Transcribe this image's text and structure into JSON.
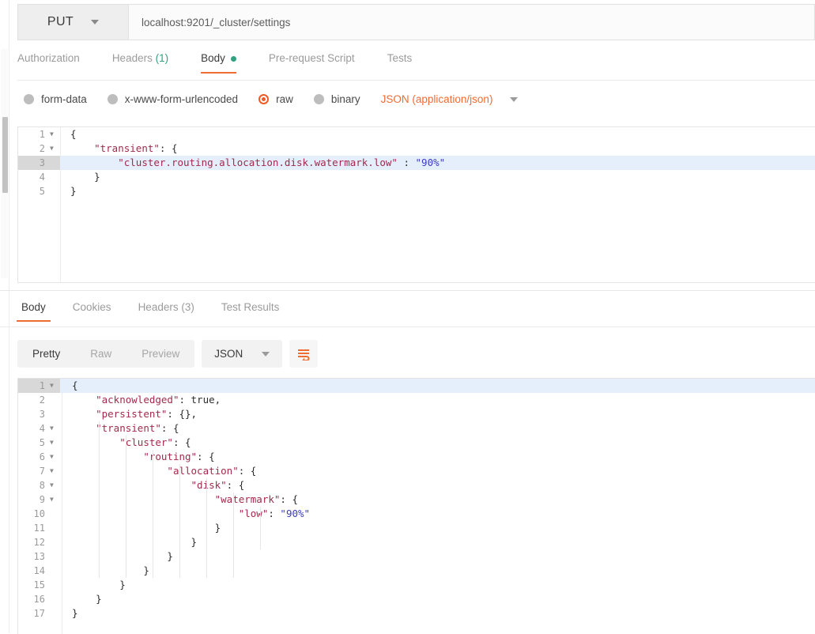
{
  "request": {
    "method": "PUT",
    "url": "localhost:9201/_cluster/settings",
    "tabs": [
      {
        "label": "Authorization",
        "active": false,
        "count": "",
        "dot": false
      },
      {
        "label": "Headers",
        "active": false,
        "count": "(1)",
        "dot": false
      },
      {
        "label": "Body",
        "active": true,
        "count": "",
        "dot": true
      },
      {
        "label": "Pre-request Script",
        "active": false,
        "count": "",
        "dot": false
      },
      {
        "label": "Tests",
        "active": false,
        "count": "",
        "dot": false
      }
    ],
    "body_types": [
      {
        "label": "form-data",
        "selected": false
      },
      {
        "label": "x-www-form-urlencoded",
        "selected": false
      },
      {
        "label": "raw",
        "selected": true
      },
      {
        "label": "binary",
        "selected": false
      }
    ],
    "content_type": "JSON (application/json)",
    "body_lines": [
      {
        "num": "1",
        "fold": "▾",
        "highlight": false,
        "text": "{"
      },
      {
        "num": "2",
        "fold": "▾",
        "highlight": false,
        "text": "    \"transient\": {"
      },
      {
        "num": "3",
        "fold": "",
        "highlight": true,
        "text": "        \"cluster.routing.allocation.disk.watermark.low\" : \"90%\""
      },
      {
        "num": "4",
        "fold": "",
        "highlight": false,
        "text": "    }"
      },
      {
        "num": "5",
        "fold": "",
        "highlight": false,
        "text": "}"
      }
    ]
  },
  "response": {
    "tabs": [
      {
        "label": "Body",
        "active": true,
        "count": ""
      },
      {
        "label": "Cookies",
        "active": false,
        "count": ""
      },
      {
        "label": "Headers",
        "active": false,
        "count": "(3)"
      },
      {
        "label": "Test Results",
        "active": false,
        "count": ""
      }
    ],
    "format_modes": [
      {
        "label": "Pretty",
        "active": true
      },
      {
        "label": "Raw",
        "active": false
      },
      {
        "label": "Preview",
        "active": false
      }
    ],
    "format_select": "JSON",
    "wrap_icon": "word-wrap-icon",
    "body_lines": [
      {
        "num": "1",
        "fold": "▾",
        "highlight": true,
        "text": "{"
      },
      {
        "num": "2",
        "fold": "",
        "highlight": false,
        "text": "    \"acknowledged\": true,"
      },
      {
        "num": "3",
        "fold": "",
        "highlight": false,
        "text": "    \"persistent\": {},"
      },
      {
        "num": "4",
        "fold": "▾",
        "highlight": false,
        "text": "    \"transient\": {"
      },
      {
        "num": "5",
        "fold": "▾",
        "highlight": false,
        "text": "        \"cluster\": {"
      },
      {
        "num": "6",
        "fold": "▾",
        "highlight": false,
        "text": "            \"routing\": {"
      },
      {
        "num": "7",
        "fold": "▾",
        "highlight": false,
        "text": "                \"allocation\": {"
      },
      {
        "num": "8",
        "fold": "▾",
        "highlight": false,
        "text": "                    \"disk\": {"
      },
      {
        "num": "9",
        "fold": "▾",
        "highlight": false,
        "text": "                        \"watermark\": {"
      },
      {
        "num": "10",
        "fold": "",
        "highlight": false,
        "text": "                            \"low\": \"90%\""
      },
      {
        "num": "11",
        "fold": "",
        "highlight": false,
        "text": "                        }"
      },
      {
        "num": "12",
        "fold": "",
        "highlight": false,
        "text": "                    }"
      },
      {
        "num": "13",
        "fold": "",
        "highlight": false,
        "text": "                }"
      },
      {
        "num": "14",
        "fold": "",
        "highlight": false,
        "text": "            }"
      },
      {
        "num": "15",
        "fold": "",
        "highlight": false,
        "text": "        }"
      },
      {
        "num": "16",
        "fold": "",
        "highlight": false,
        "text": "    }"
      },
      {
        "num": "17",
        "fold": "",
        "highlight": false,
        "text": "}"
      }
    ]
  },
  "colors": {
    "accent": "#ef6c33",
    "teal": "#2fa27f",
    "highlight": "#e4effb",
    "key": "#a22a4d",
    "string": "#3b3bc4"
  }
}
